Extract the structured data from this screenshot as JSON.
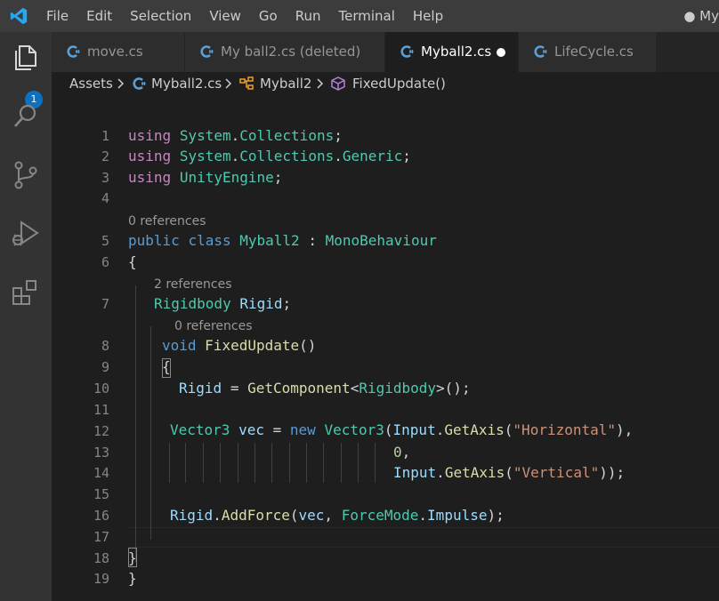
{
  "menu": [
    "File",
    "Edit",
    "Selection",
    "View",
    "Go",
    "Run",
    "Terminal",
    "Help"
  ],
  "window_title": "● My",
  "activity": {
    "explorer_badge": "1"
  },
  "tabs": [
    {
      "label": "move.cs"
    },
    {
      "label": "My ball2.cs (deleted)"
    },
    {
      "label": "Myball2.cs",
      "active": true,
      "modified": true
    },
    {
      "label": "LifeCycle.cs"
    }
  ],
  "breadcrumb": {
    "folder": "Assets",
    "file": "Myball2.cs",
    "class": "Myball2",
    "method": "FixedUpdate()"
  },
  "editor": {
    "line_numbers": [
      "1",
      "2",
      "3",
      "4",
      "5",
      "6",
      "7",
      "8",
      "9",
      "10",
      "11",
      "12",
      "13",
      "14",
      "15",
      "16",
      "17",
      "18",
      "19"
    ],
    "codelens": {
      "class_refs": "0 references",
      "field_refs": "2 references",
      "method_refs": "0 references"
    },
    "lines": {
      "l1": [
        "using",
        "System",
        ".",
        "Collections",
        ";"
      ],
      "l2": [
        "using",
        "System",
        ".",
        "Collections",
        ".",
        "Generic",
        ";"
      ],
      "l3": [
        "using",
        "UnityEngine",
        ";"
      ],
      "l5": [
        "public",
        "class",
        "Myball2",
        ":",
        "MonoBehaviour"
      ],
      "l6": "{",
      "l7": [
        "Rigidbody",
        "Rigid",
        ";"
      ],
      "l8": [
        "void",
        "FixedUpdate",
        "()"
      ],
      "l9": "{",
      "l10": [
        "Rigid",
        "=",
        "GetComponent",
        "<",
        "Rigidbody",
        ">",
        "();"
      ],
      "l12": [
        "Vector3",
        "vec",
        "=",
        "new",
        "Vector3",
        "(",
        "Input",
        ".",
        "GetAxis",
        "(",
        "\"Horizontal\"",
        "),"
      ],
      "l13": [
        "0",
        ","
      ],
      "l14": [
        "Input",
        ".",
        "GetAxis",
        "(",
        "\"Vertical\"",
        "));"
      ],
      "l16": [
        "Rigid",
        ".",
        "AddForce",
        "(",
        "vec",
        ",",
        "ForceMode",
        ".",
        "Impulse",
        ");"
      ],
      "l18": "}",
      "l19": "}"
    }
  },
  "colors": {
    "keyword": "#c586c0",
    "type": "#4ec9b0",
    "string": "#ce9178",
    "method": "#dcdcaa",
    "variable": "#9cdcfe"
  }
}
